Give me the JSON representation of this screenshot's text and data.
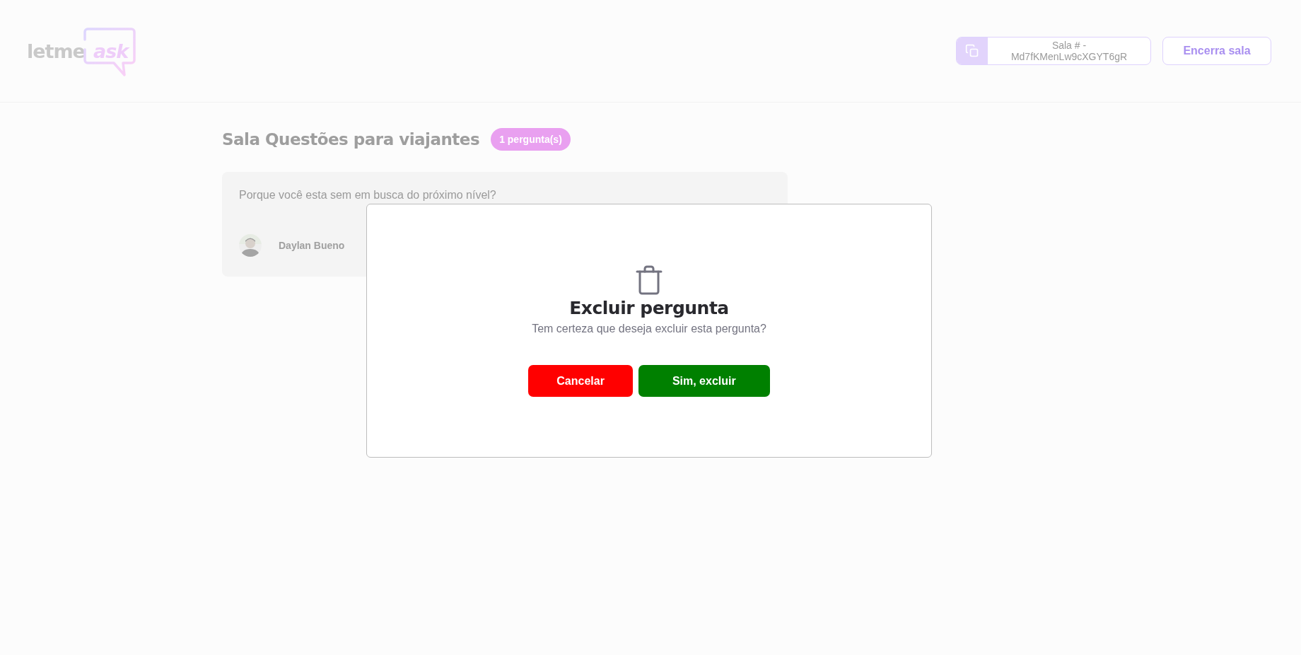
{
  "header": {
    "logo": {
      "word": "letme",
      "accent": "ask"
    },
    "room_code": {
      "label": "Sala # - Md7fKMenLw9cXGYT6gR"
    },
    "close_room_button": "Encerra sala"
  },
  "room": {
    "title": "Sala Questões para viajantes",
    "badge": "1 pergunta(s)"
  },
  "questions": [
    {
      "text": "Porque você esta sem em busca do próximo nível?",
      "author": "Daylan Bueno"
    }
  ],
  "modal": {
    "open": true,
    "title": "Excluir pergunta",
    "message": "Tem certeza que deseja excluir esta pergunta?",
    "buttons": [
      {
        "label": "Cancelar",
        "kind": "cancel"
      },
      {
        "label": "Sim, excluir",
        "kind": "confirm"
      }
    ]
  }
}
